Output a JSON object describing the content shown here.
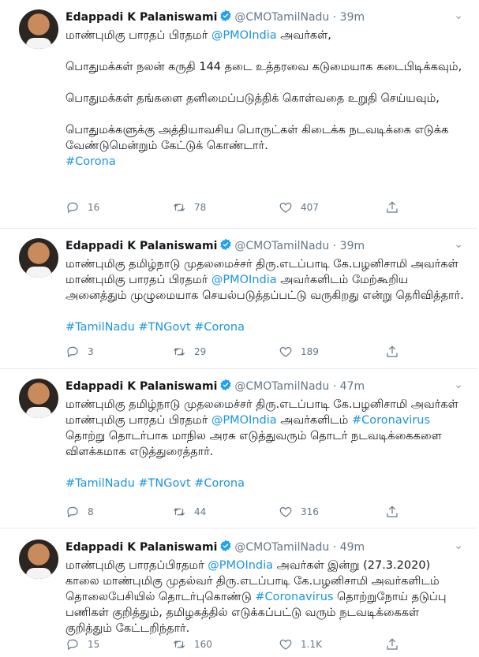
{
  "tweets": [
    {
      "name": "Edappadi K Palaniswami",
      "handle": "@CMOTamilNadu",
      "time": "39m",
      "line1a": "மாண்புமிகு பாரதப் பிரதமர் ",
      "line1_mention": "@PMOIndia",
      "line1b": " அவர்கள்,",
      "p2": "பொதுமக்கள் நலன் கருதி 144 தடை உத்தரவை கடுமையாக கடைபிடிக்கவும்,",
      "p3": "பொதுமக்கள் தங்களை தனிமைப்படுத்திக் கொள்வதை உறுதி செய்யவும்,",
      "p4": "பொதுமக்களுக்கு அத்தியாவசிய பொருட்கள் கிடைக்க நடவடிக்கை எடுக்க வேண்டுமென்றும் கேட்டுக் கொண்டார்.",
      "hashtag": "#Corona",
      "replies": "16",
      "retweets": "78",
      "likes": "407"
    },
    {
      "name": "Edappadi K Palaniswami",
      "handle": "@CMOTamilNadu",
      "time": "39m",
      "text_a": "மாண்புமிகு தமிழ்நாடு முதலமைச்சர் திரு.எடப்பாடி கே.பழனிசாமி அவர்கள் மாண்புமிகு பாரதப் பிரதமர் ",
      "mention": "@PMOIndia",
      "text_b": " அவர்களிடம் மேற்கூறிய அனைத்தும் முழுமையாக செயல்படுத்தப்பட்டு வருகிறது என்று தெரிவித்தார்.",
      "hashtags": "#TamilNadu #TNGovt #Corona",
      "replies": "3",
      "retweets": "29",
      "likes": "189"
    },
    {
      "name": "Edappadi K Palaniswami",
      "handle": "@CMOTamilNadu",
      "time": "47m",
      "text_a": "மாண்புமிகு  தமிழ்நாடு முதலமைச்சர் திரு.எடப்பாடி கே.பழனிசாமி அவர்கள் மாண்புமிகு பாரதப் பிரதமர் ",
      "mention": "@PMOIndia",
      "text_b": " அவர்களிடம் ",
      "mention2": "#Coronavirus",
      "text_c": " தொற்று தொடர்பாக மாநில அரசு எடுத்துவரும் தொடர் நடவடிக்கைகளை விளக்கமாக எடுத்துரைத்தார்.",
      "hashtags": "#TamilNadu #TNGovt #Corona",
      "replies": "8",
      "retweets": "44",
      "likes": "316"
    },
    {
      "name": "Edappadi K Palaniswami",
      "handle": "@CMOTamilNadu",
      "time": "49m",
      "text_a": "மாண்புமிகு பாரதப்பிரதமர் ",
      "mention": "@PMOIndia",
      "text_b": " அவர்கள் இன்று (27.3.2020) காலை மாண்புமிகு முதல்வர் திரு.எடப்பாடி கே.பழனிசாமி அவர்களிடம் தொலைபேசியில் தொடர்புகொண்டு ",
      "mention2": "#Coronavirus",
      "text_c": " தொற்றுநோய் தடுப்பு பணிகள் குறித்தும், தமிழகத்தில் எடுக்கப்பட்டு வரும் நடவடிக்கைகள் குறித்தும் கேட்டறிந்தார்.",
      "replies": "15",
      "retweets": "160",
      "likes": "1.1K"
    }
  ],
  "colors": {
    "link": "#1b95e0",
    "verified": "#1da1f2",
    "muted": "#657786"
  },
  "icons": [
    "reply-icon",
    "retweet-icon",
    "like-icon",
    "share-icon",
    "verified-icon",
    "chevron-down-icon"
  ]
}
